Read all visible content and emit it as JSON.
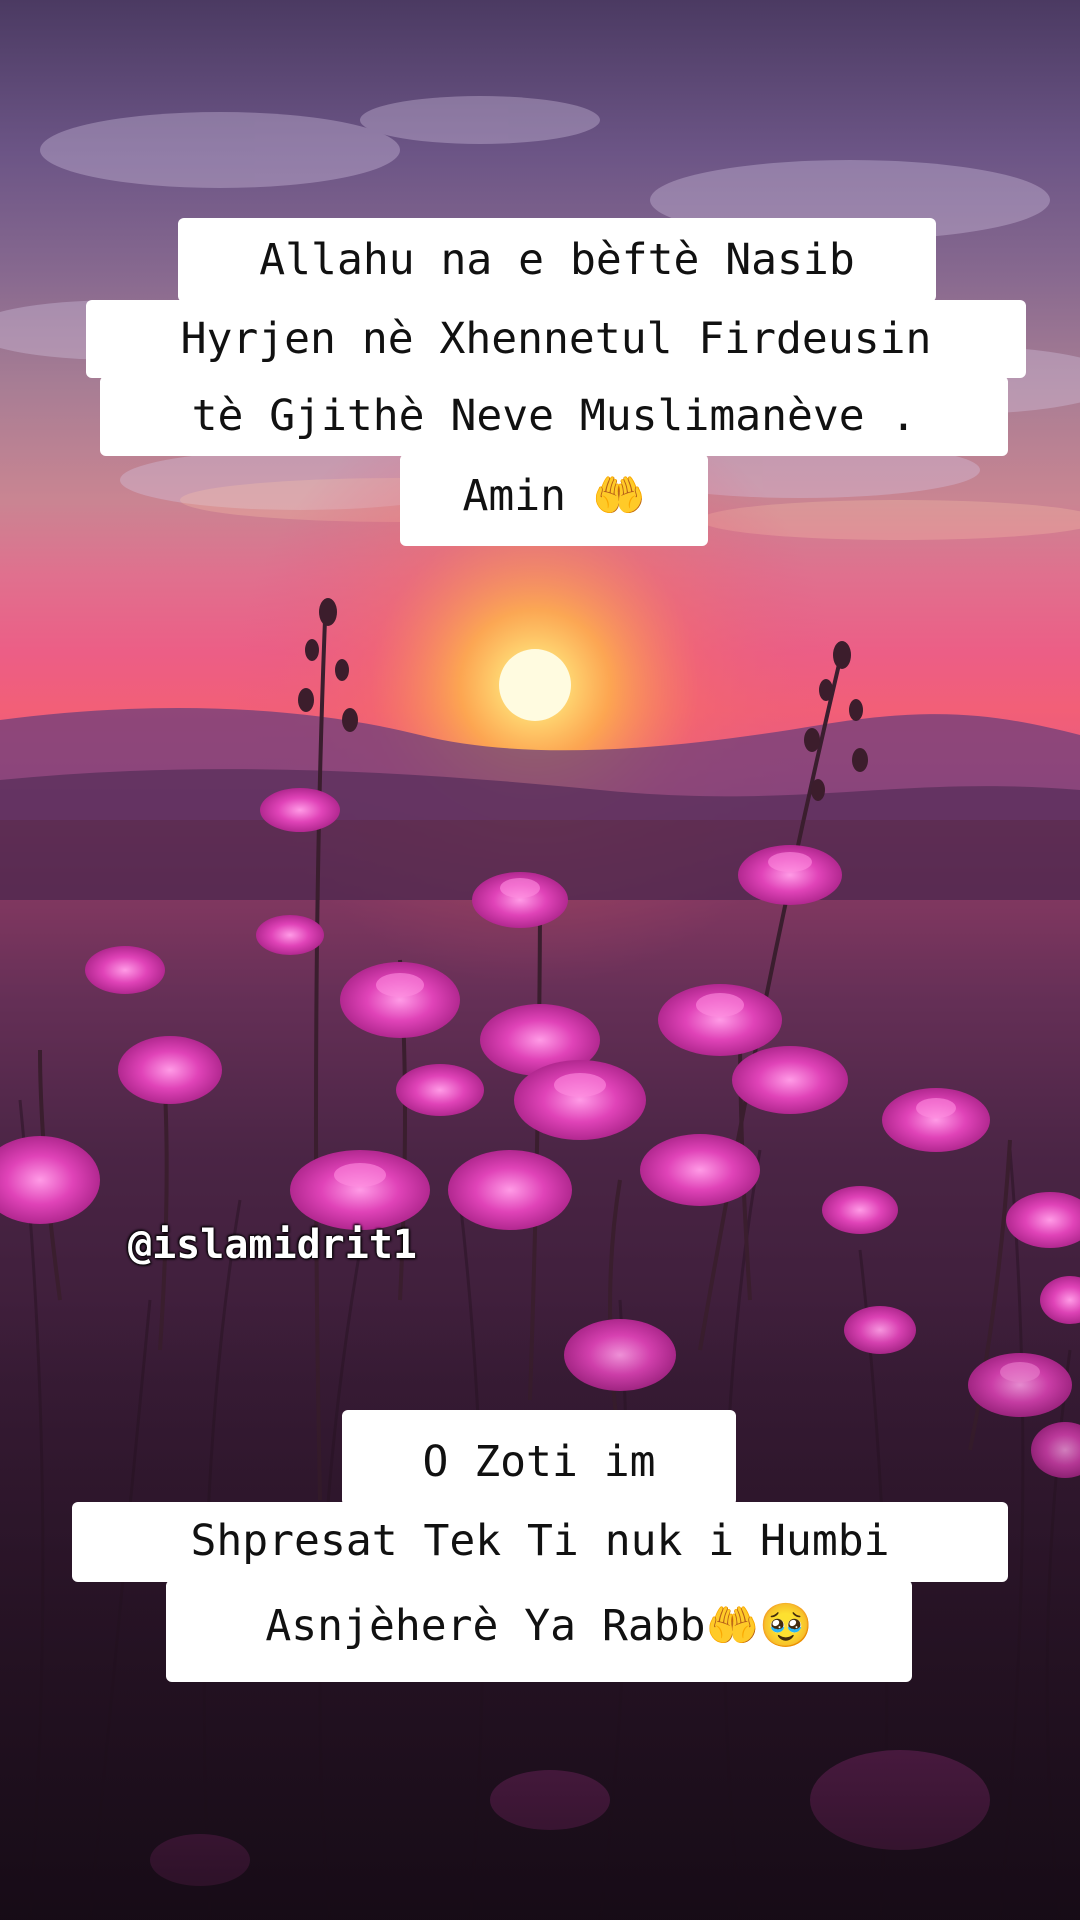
{
  "top_text": {
    "line1": "Allahu na e bèftè Nasib",
    "line2": "Hyrjen nè Xhennetul Firdeusin",
    "line3": "tè Gjithè Neve Muslimanève .",
    "line4": "Amin 🤲"
  },
  "watermark": "@islamidrit1",
  "bottom_text": {
    "line1": "O Zoti im",
    "line2": "Shpresat Tek Ti nuk i Humbi",
    "line3": "Asnjèherè Ya Rabb🤲🥹"
  },
  "colors": {
    "sun": "#fff6c8",
    "flower": "#e040b8",
    "stem": "#3a1e2e"
  }
}
